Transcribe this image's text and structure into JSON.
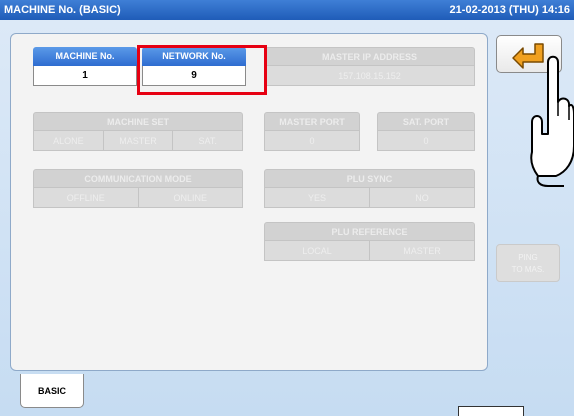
{
  "window": {
    "title": "MACHINE No. (BASIC)",
    "clock": "21-02-2013 (THU) 14:16"
  },
  "machine_no": {
    "label": "MACHINE No.",
    "value": "1"
  },
  "network_no": {
    "label": "NETWORK No.",
    "value": "9"
  },
  "master_ip": {
    "label": "MASTER IP ADDRESS",
    "value": "157.108.15.152"
  },
  "machine_set": {
    "label": "MACHINE SET",
    "options": [
      "ALONE",
      "MASTER",
      "SAT."
    ]
  },
  "master_port": {
    "label": "MASTER PORT",
    "value": "0"
  },
  "sat_port": {
    "label": "SAT. PORT",
    "value": "0"
  },
  "communication_mode": {
    "label": "COMMUNICATION MODE",
    "options": [
      "OFFLINE",
      "ONLINE"
    ]
  },
  "plu_sync": {
    "label": "PLU SYNC",
    "options": [
      "YES",
      "NO"
    ]
  },
  "plu_reference": {
    "label": "PLU REFERENCE",
    "options": [
      "LOCAL",
      "MASTER"
    ]
  },
  "ping_button": {
    "line1": "PING",
    "line2": "TO MAS."
  },
  "tab": {
    "label": "BASIC"
  },
  "icons": {
    "back": "return-arrow-icon",
    "pointer": "pointing-hand-icon"
  },
  "colors": {
    "titlebar": "#2e6cd0",
    "header_active": "#3d7fe0",
    "highlight": "#e60012",
    "accent": "#f0a020"
  }
}
